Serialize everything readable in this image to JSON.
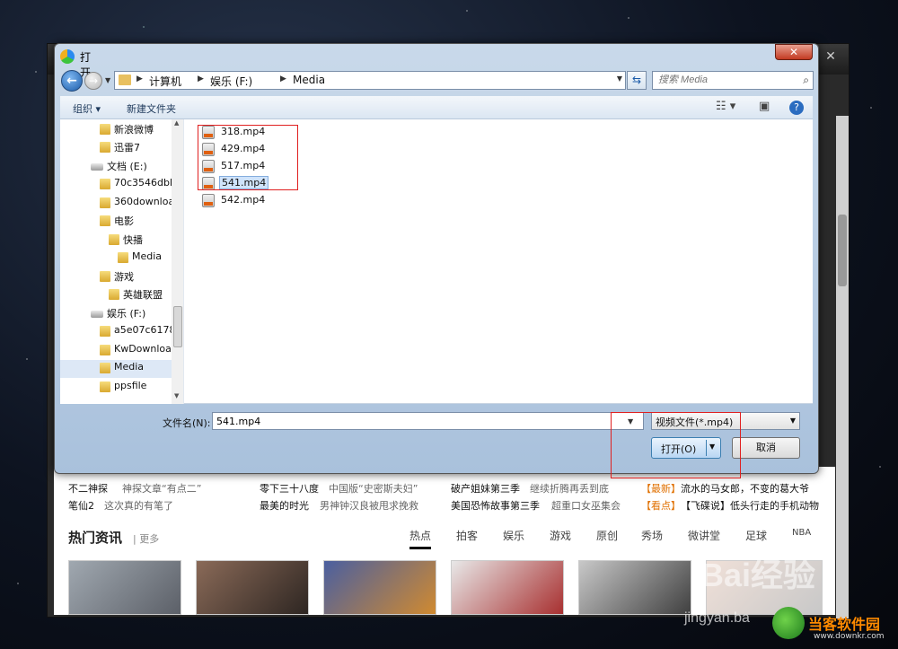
{
  "dialog": {
    "title": "打开",
    "close_label": "✕",
    "address": {
      "crumbs": [
        "计算机",
        "娱乐 (F:)",
        "Media"
      ]
    },
    "search_placeholder": "搜索 Media",
    "toolbar": {
      "organize": "组织 ▾",
      "new_folder": "新建文件夹"
    },
    "nav_tree": [
      {
        "label": "新浪微博",
        "kind": "folder"
      },
      {
        "label": "迅雷7",
        "kind": "folder"
      },
      {
        "label": "文档 (E:)",
        "kind": "drive"
      },
      {
        "label": "70c3546dbb",
        "kind": "folder"
      },
      {
        "label": "360downloa",
        "kind": "folder"
      },
      {
        "label": "电影",
        "kind": "folder"
      },
      {
        "label": "快播",
        "kind": "folder"
      },
      {
        "label": "Media",
        "kind": "folder"
      },
      {
        "label": "游戏",
        "kind": "folder"
      },
      {
        "label": "英雄联盟",
        "kind": "folder"
      },
      {
        "label": "娱乐 (F:)",
        "kind": "drive"
      },
      {
        "label": "a5e07c6178",
        "kind": "folder"
      },
      {
        "label": "KwDownloa",
        "kind": "folder"
      },
      {
        "label": "Media",
        "kind": "folder",
        "selected": true
      },
      {
        "label": "ppsfile",
        "kind": "folder"
      }
    ],
    "files": [
      {
        "name": "318.mp4"
      },
      {
        "name": "429.mp4"
      },
      {
        "name": "517.mp4"
      },
      {
        "name": "541.mp4",
        "selected": true
      },
      {
        "name": "542.mp4"
      }
    ],
    "filename_label": "文件名(N):",
    "filename_value": "541.mp4",
    "filter_value": "视频文件(*.mp4)",
    "open_label": "打开(O)",
    "cancel_label": "取消"
  },
  "background": {
    "news_rows": [
      [
        "不二神探",
        "神探文章“有点二”",
        "零下三十八度",
        "中国版“史密斯夫妇”",
        "破产姐妹第三季",
        "继续折腾再丢到底",
        "【最新】",
        "流水的马女郎，不变的葛大爷"
      ],
      [
        "笔仙2",
        "这次真的有笔了",
        "最美的时光",
        "男神钟汉良被甩求挽救",
        "美国恐怖故事第三季",
        "超重口女巫集会",
        "【看点】",
        "【飞碟说】低头行走的手机动物"
      ]
    ],
    "hot_title": "热门资讯",
    "hot_more": "| 更多",
    "hot_tabs": [
      "热点",
      "拍客",
      "娱乐",
      "游戏",
      "原创",
      "秀场",
      "微讲堂",
      "足球",
      "NBA"
    ]
  },
  "watermark": {
    "baidu": "Bai经验",
    "jingyan": "jingyan.ba",
    "site": "当客软件园",
    "url": "www.downkr.com"
  },
  "colors": {
    "accent": "#1a5aa8",
    "highlight_box": "#e02020",
    "tab_orange": "#e07000"
  }
}
